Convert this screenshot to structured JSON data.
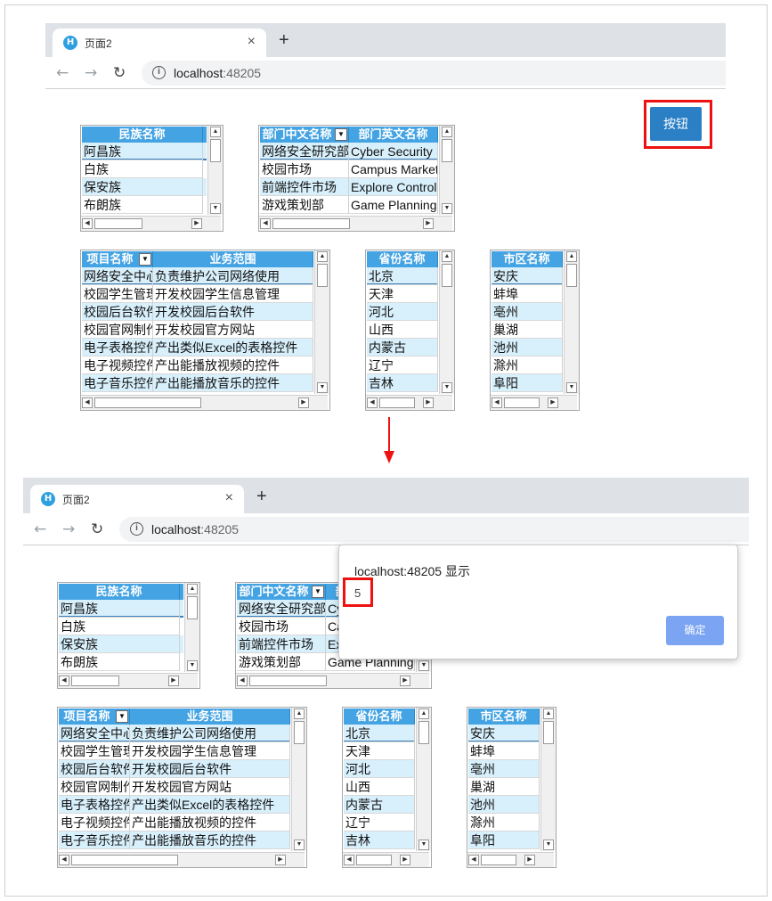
{
  "browser": {
    "tab_title": "页面2",
    "url_host": "localhost",
    "url_port": ":48205",
    "new_tab": "+",
    "close": "×"
  },
  "page": {
    "button_label": "按钮"
  },
  "grids": {
    "nation": {
      "headers": [
        "民族名称"
      ],
      "rows": [
        [
          "阿昌族"
        ],
        [
          "白族"
        ],
        [
          "保安族"
        ],
        [
          "布朗族"
        ]
      ]
    },
    "dept": {
      "headers": [
        "部门中文名称",
        "部门英文名称"
      ],
      "rows": [
        [
          "网络安全研究部",
          "Cyber Security"
        ],
        [
          "校园市场",
          "Campus Market"
        ],
        [
          "前端控件市场",
          " Explore Controls"
        ],
        [
          "游戏策划部",
          "Game Planning"
        ]
      ]
    },
    "project": {
      "headers": [
        "项目名称",
        "业务范围"
      ],
      "rows": [
        [
          "网络安全中心",
          "负责维护公司网络使用"
        ],
        [
          "校园学生管理",
          "开发校园学生信息管理"
        ],
        [
          "校园后台软件",
          "开发校园后台软件"
        ],
        [
          "校园官网制作",
          "开发校园官方网站"
        ],
        [
          "电子表格控件",
          "产出类似Excel的表格控件"
        ],
        [
          "电子视频控件",
          "产出能播放视频的控件"
        ],
        [
          "电子音乐控件",
          "产出能播放音乐的控件"
        ]
      ]
    },
    "province": {
      "headers": [
        "省份名称"
      ],
      "rows": [
        [
          "北京"
        ],
        [
          "天津"
        ],
        [
          "河北"
        ],
        [
          "山西"
        ],
        [
          "内蒙古"
        ],
        [
          "辽宁"
        ],
        [
          "吉林"
        ]
      ]
    },
    "city": {
      "headers": [
        "市区名称"
      ],
      "rows": [
        [
          "安庆"
        ],
        [
          "蚌埠"
        ],
        [
          "亳州"
        ],
        [
          "巢湖"
        ],
        [
          "池州"
        ],
        [
          "滁州"
        ],
        [
          "阜阳"
        ]
      ]
    }
  },
  "dialog": {
    "title": "localhost:48205 显示",
    "message": "5",
    "ok_label": "确定"
  },
  "colors": {
    "accent": "#2a7fc5",
    "grid_header": "#44a3e3",
    "highlight": "#e11111",
    "dialog_ok": "#7ba4f2"
  }
}
